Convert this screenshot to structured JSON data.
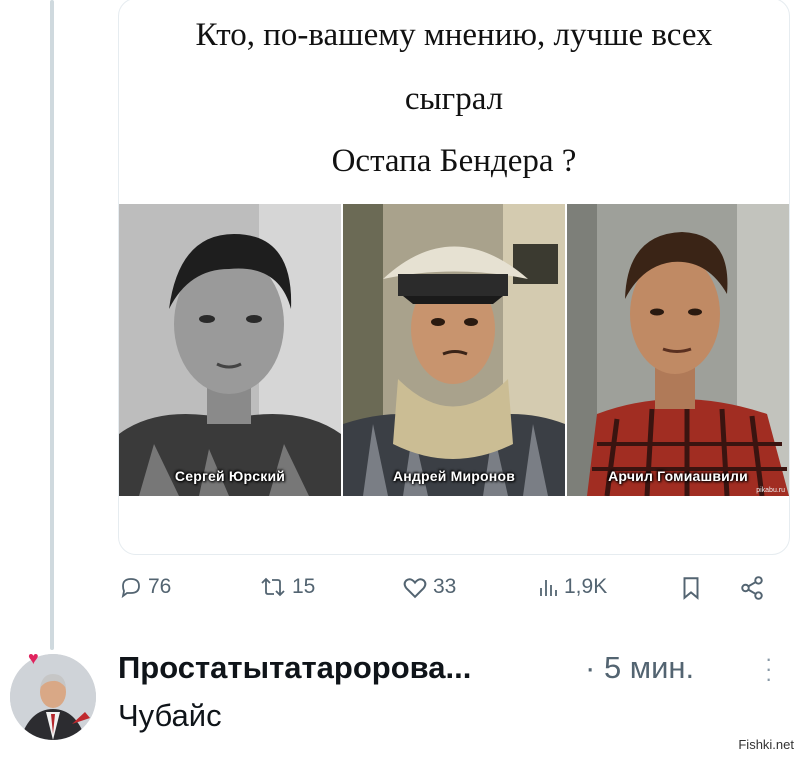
{
  "post": {
    "caption_line1": "Кто, по-вашему мнению, лучше всех",
    "caption_line2": "сыграл",
    "caption_line3": "Остапа Бендера ?",
    "photos": [
      {
        "name": "Сергей Юрский"
      },
      {
        "name": "Андрей Миронов"
      },
      {
        "name": "Арчил Гомиашвили"
      }
    ],
    "photo_watermark": "pikabu.ru"
  },
  "actions": {
    "replies": "76",
    "reposts": "15",
    "likes": "33",
    "views": "1,9K"
  },
  "reply": {
    "author": "Простатытатаророва...",
    "separator": "·",
    "time": "5 мин.",
    "text": "Чубайс"
  },
  "watermark": "Fishki.net",
  "colors": {
    "accent_gray": "#536471",
    "thread_line": "#cfd9de",
    "heart": "#e0245e"
  }
}
